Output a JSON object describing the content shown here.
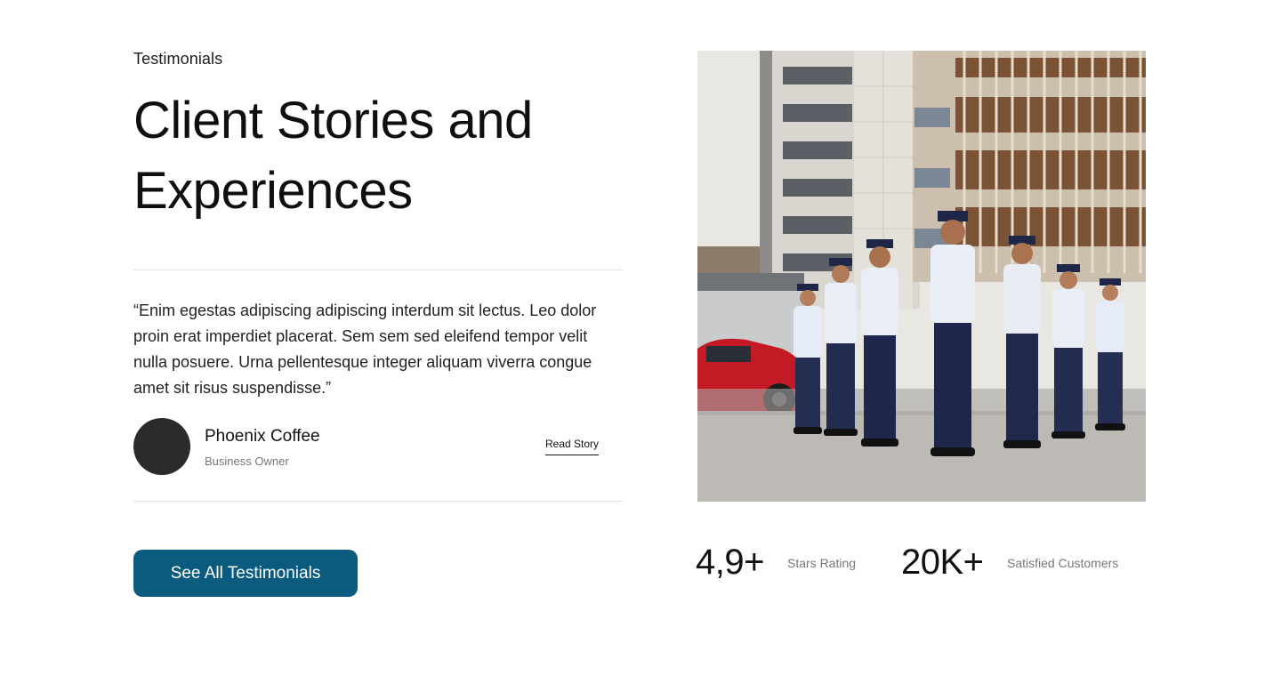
{
  "testimonials": {
    "eyebrow": "Testimonials",
    "title": "Client Stories and Experiences",
    "quote": "“Enim egestas adipiscing adipiscing interdum sit lectus. Leo dolor proin erat imperdiet placerat. Sem sem sed eleifend tempor velit nulla posuere. Urna pellentesque integer aliquam viverra congue amet sit risus suspendisse.”",
    "author": {
      "name": "Phoenix Coffee",
      "role": "Business Owner"
    },
    "read_story_label": "Read Story",
    "cta_label": "See All Testimonials"
  },
  "stats": [
    {
      "value": "4,9+",
      "label": "Stars Rating"
    },
    {
      "value": "20K+",
      "label": "Satisfied Customers"
    }
  ],
  "colors": {
    "primary": "#0b5b7f",
    "avatar": "#2b2b2b",
    "divider": "#e2e2e2"
  }
}
